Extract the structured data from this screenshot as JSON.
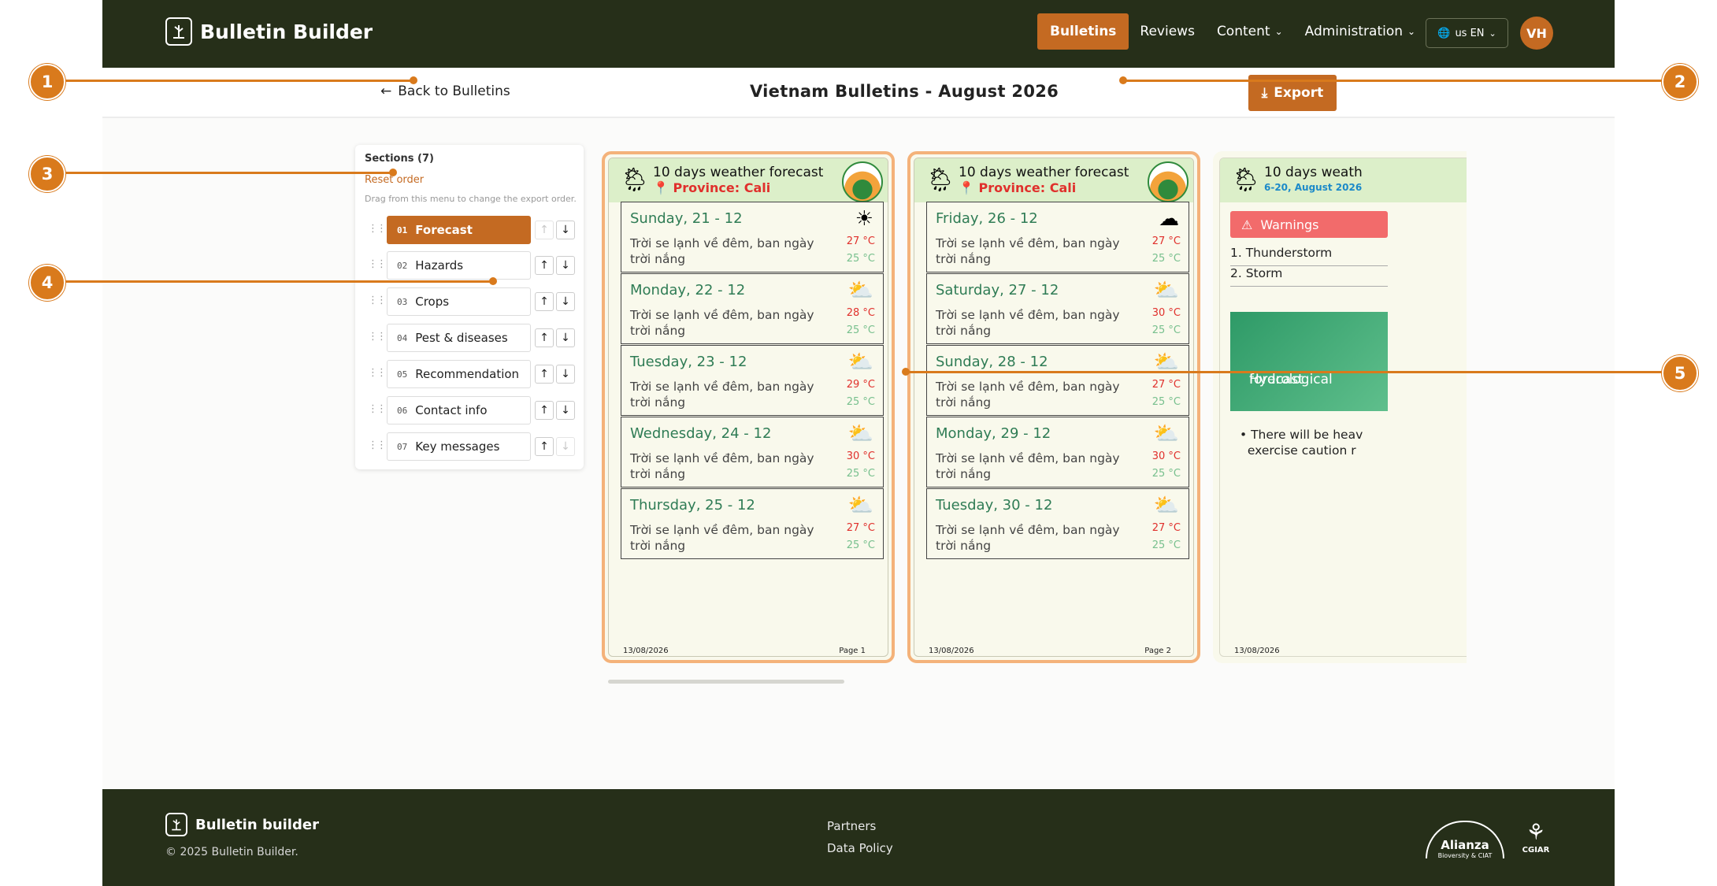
{
  "header": {
    "brand": "Bulletin Builder",
    "nav": [
      {
        "label": "Bulletins",
        "active": true,
        "dropdown": false
      },
      {
        "label": "Reviews",
        "active": false,
        "dropdown": false
      },
      {
        "label": "Content",
        "active": false,
        "dropdown": true
      },
      {
        "label": "Administration",
        "active": false,
        "dropdown": true
      }
    ],
    "language": "us EN",
    "avatar_initials": "VH"
  },
  "subheader": {
    "back_label": "Back to Bulletins",
    "title": "Vietnam Bulletins - August 2026",
    "export_label": "Export"
  },
  "sidebar": {
    "title": "Sections (7)",
    "reset_label": "Reset order",
    "hint": "Drag from this menu to change the export order.",
    "sections": [
      {
        "num": "01",
        "label": "Forecast",
        "active": true
      },
      {
        "num": "02",
        "label": "Hazards",
        "active": false
      },
      {
        "num": "03",
        "label": "Crops",
        "active": false
      },
      {
        "num": "04",
        "label": "Pest & diseases",
        "active": false
      },
      {
        "num": "05",
        "label": "Recommendation",
        "active": false
      },
      {
        "num": "06",
        "label": "Contact info",
        "active": false
      },
      {
        "num": "07",
        "label": "Key messages",
        "active": false
      }
    ]
  },
  "pages": [
    {
      "header_title": "10 days weather forecast",
      "province": "Province: Cali",
      "days": [
        {
          "name": "Sunday, 21 - 12",
          "desc": "Trời se lạnh về đêm, ban ngày trời nắng",
          "tmax": "27 °C",
          "tmin": "25 °C",
          "icon": "sun-icon"
        },
        {
          "name": "Monday, 22 - 12",
          "desc": "Trời se lạnh về đêm, ban ngày trời nắng",
          "tmax": "28 °C",
          "tmin": "25 °C",
          "icon": "partly-cloudy-icon"
        },
        {
          "name": "Tuesday, 23 - 12",
          "desc": "Trời se lạnh về đêm, ban ngày trời nắng",
          "tmax": "29 °C",
          "tmin": "25 °C",
          "icon": "partly-cloudy-icon"
        },
        {
          "name": "Wednesday, 24 - 12",
          "desc": "Trời se lạnh về đêm, ban ngày trời nắng",
          "tmax": "30 °C",
          "tmin": "25 °C",
          "icon": "partly-cloudy-icon"
        },
        {
          "name": "Thursday, 25 - 12",
          "desc": "Trời se lạnh về đêm, ban ngày trời nắng",
          "tmax": "27 °C",
          "tmin": "25 °C",
          "icon": "partly-cloudy-icon"
        }
      ],
      "date": "13/08/2026",
      "page_label": "Page 1"
    },
    {
      "header_title": "10 days weather forecast",
      "province": "Province: Cali",
      "days": [
        {
          "name": "Friday, 26 - 12",
          "desc": "Trời se lạnh về đêm, ban ngày trời nắng",
          "tmax": "27 °C",
          "tmin": "25 °C",
          "icon": "cloudy-icon"
        },
        {
          "name": "Saturday, 27 - 12",
          "desc": "Trời se lạnh về đêm, ban ngày trời nắng",
          "tmax": "30 °C",
          "tmin": "25 °C",
          "icon": "partly-cloudy-icon"
        },
        {
          "name": "Sunday, 28 - 12",
          "desc": "Trời se lạnh về đêm, ban ngày trời nắng",
          "tmax": "27 °C",
          "tmin": "25 °C",
          "icon": "partly-cloudy-icon"
        },
        {
          "name": "Monday, 29 - 12",
          "desc": "Trời se lạnh về đêm, ban ngày trời nắng",
          "tmax": "30 °C",
          "tmin": "25 °C",
          "icon": "partly-cloudy-icon"
        },
        {
          "name": "Tuesday, 30 - 12",
          "desc": "Trời se lạnh về đêm, ban ngày trời nắng",
          "tmax": "27 °C",
          "tmin": "25 °C",
          "icon": "partly-cloudy-icon"
        }
      ],
      "date": "13/08/2026",
      "page_label": "Page 2"
    },
    {
      "header_title": "10 days weath",
      "subtitle": "6-20, August 2026",
      "warnings_label": "Warnings",
      "warnings": [
        "1. Thunderstorm",
        "2. Storm"
      ],
      "hydro_label_1": "Hydrological",
      "hydro_label_2": "forecast",
      "bullet_1": "There will be heav",
      "bullet_2": "exercise caution r",
      "date": "13/08/2026"
    }
  ],
  "footer": {
    "brand": "Bulletin builder",
    "copyright": "© 2025 Bulletin Builder.",
    "links": [
      "Partners",
      "Data Policy"
    ],
    "alianza_name": "Alianza",
    "alianza_sub": "Bioversity & CIAT",
    "cgiar": "CGIAR"
  },
  "callouts": [
    "1",
    "2",
    "3",
    "4",
    "5"
  ],
  "colors": {
    "accent": "#c46a22",
    "header_bg": "#262f19",
    "callout": "#d97a1c",
    "temp_max": "#e0302c",
    "temp_min": "#78c08e"
  }
}
